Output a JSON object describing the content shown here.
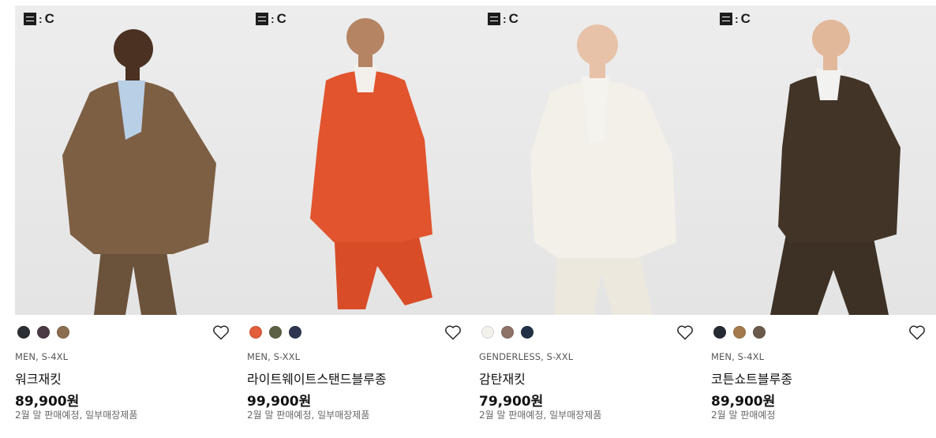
{
  "products": [
    {
      "brand_badge": "C",
      "colors": [
        "#2b2e33",
        "#4a3a44",
        "#8a6c4f"
      ],
      "category": "MEN, S-4XL",
      "name": "워크재킷",
      "price": "89,900원",
      "availability": "2월 말 판매예정, 일부매장제품",
      "garment": "#7d5f43",
      "pants": "#6b523b",
      "shirt": "#b9cfe6",
      "skin": "#4a3122"
    },
    {
      "brand_badge": "C",
      "colors": [
        "#e25d3a",
        "#5d6144",
        "#2d3550"
      ],
      "category": "MEN, S-XXL",
      "name": "라이트웨이트스탠드블루종",
      "price": "99,900원",
      "availability": "2월 말 판매예정, 일부매장제품",
      "garment": "#e1542e",
      "pants": "#d84c28",
      "shirt": "#f3f0ec",
      "skin": "#b58463"
    },
    {
      "brand_badge": "C",
      "colors": [
        "#f3f1ec",
        "#8c7267",
        "#223046"
      ],
      "category": "GENDERLESS, S-XXL",
      "name": "감탄재킷",
      "price": "79,900원",
      "availability": "2월 말 판매예정, 일부매장제품",
      "garment": "#f2f0e9",
      "pants": "#ece8de",
      "shirt": "#f5f3ee",
      "skin": "#e7c2a8"
    },
    {
      "brand_badge": "C",
      "colors": [
        "#252a33",
        "#a47a4c",
        "#6a5a4c"
      ],
      "category": "MEN, S-4XL",
      "name": "코튼쇼트블루종",
      "price": "89,900원",
      "availability": "2월 말 판매예정",
      "garment": "#433428",
      "pants": "#3d3025",
      "shirt": "#f2f2f0",
      "skin": "#e2b89a"
    }
  ]
}
